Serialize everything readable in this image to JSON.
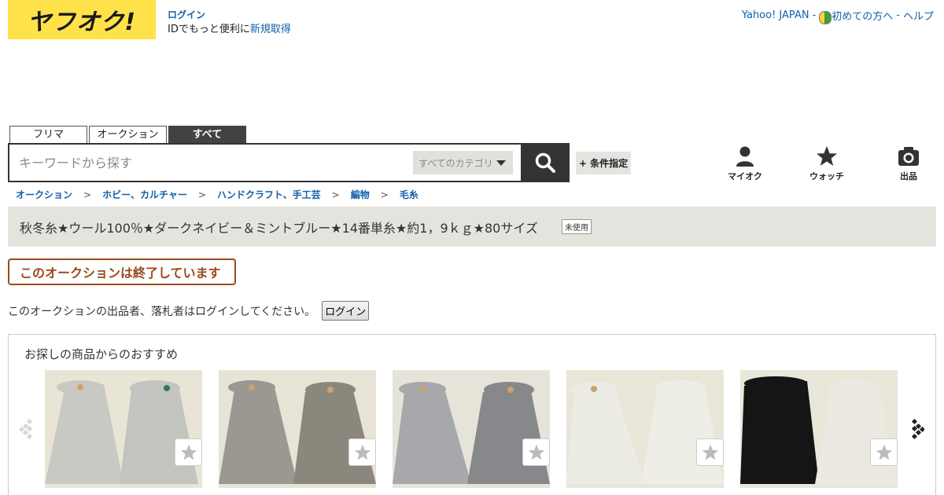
{
  "header": {
    "logo_text": "ヤフオク!",
    "login_link": "ログイン",
    "login_prompt_prefix": "IDでもっと便利に",
    "signup_link": "新規取得",
    "top_links": {
      "yahoo_japan": "Yahoo! JAPAN",
      "beginner": "初めての方へ",
      "help": "ヘルプ",
      "separator": "-"
    }
  },
  "tabs": [
    {
      "label": "フリマ",
      "active": false
    },
    {
      "label": "オークション",
      "active": false
    },
    {
      "label": "すべて",
      "active": true
    }
  ],
  "search": {
    "placeholder": "キーワードから探す",
    "value": "",
    "category_selected": "すべてのカテゴリ",
    "condition_button": "+ 条件指定"
  },
  "nav": {
    "my_auction": "マイオク",
    "watch": "ウォッチ",
    "sell": "出品"
  },
  "breadcrumb": [
    "オークション",
    "ホビー、カルチャー",
    "ハンドクラフト、手工芸",
    "編物",
    "毛糸"
  ],
  "breadcrumb_separator": ">",
  "item": {
    "title": "秋冬糸★ウール100％★ダークネイビー＆ミントブルー★14番単糸★約1，9ｋｇ★80サイズ",
    "condition_badge": "未使用",
    "ended_message": "このオークションは終了しています",
    "login_notice": "このオークションの出品者、落札者はログインしてください。",
    "login_button": "ログイン"
  },
  "recommend": {
    "title": "お探しの商品からのおすすめ",
    "items": [
      {
        "left_color": "#c9c9c4",
        "right_color": "#c3c4bf",
        "bg": "#e9e5d6"
      },
      {
        "left_color": "#9a9890",
        "right_color": "#8b877c",
        "bg": "#e7e3d6"
      },
      {
        "left_color": "#a6a8ac",
        "right_color": "#86888b",
        "bg": "#e6e3d8"
      },
      {
        "left_color": "#ecebe4",
        "right_color": "#efeee6",
        "bg": "#e8e5d9"
      },
      {
        "left_color": "#151515",
        "right_color": "#ebe9e1",
        "bg": "#e9e6da"
      }
    ]
  }
}
